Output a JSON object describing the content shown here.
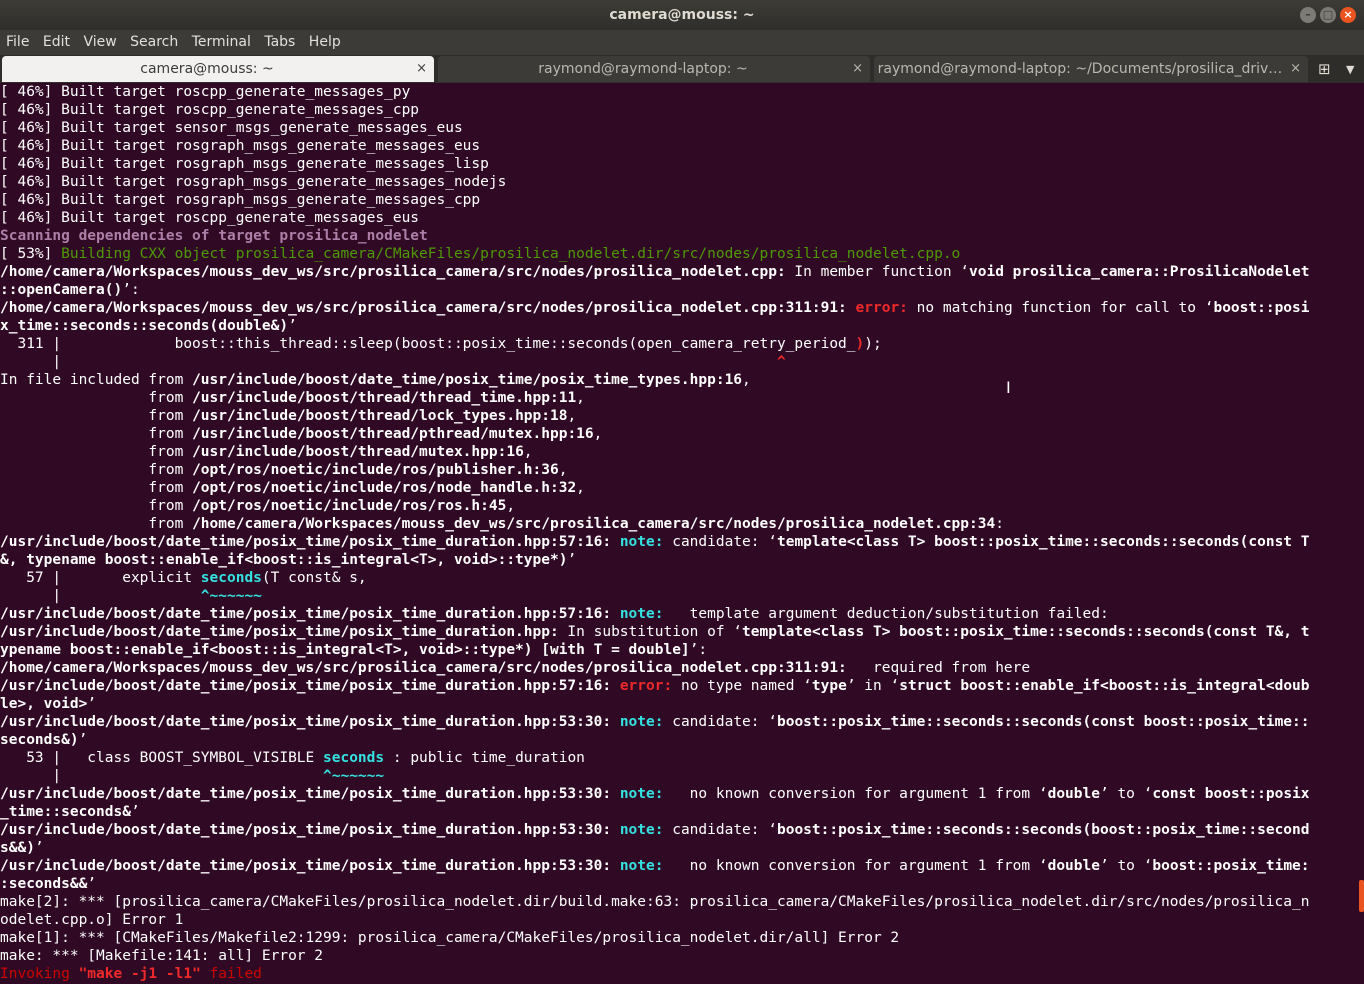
{
  "window": {
    "title": "camera@mouss: ~"
  },
  "menu": [
    "File",
    "Edit",
    "View",
    "Search",
    "Terminal",
    "Tabs",
    "Help"
  ],
  "tabs": [
    {
      "label": "camera@mouss: ~",
      "active": true
    },
    {
      "label": "raymond@raymond-laptop: ~",
      "active": false
    },
    {
      "label": "raymond@raymond-laptop: ~/Documents/prosilica_driv…",
      "active": false
    }
  ],
  "colors": {
    "terminal_bg": "#300a24",
    "accent": "#e95420",
    "note": "#34e2e2",
    "error": "#ef2929",
    "success": "#4e9a06"
  },
  "terminal": {
    "lines": [
      [
        {
          "t": "[ 46%] "
        },
        {
          "t": "Built target roscpp_generate_messages_py"
        }
      ],
      [
        {
          "t": "[ 46%] Built target roscpp_generate_messages_cpp"
        }
      ],
      [
        {
          "t": "[ 46%] Built target sensor_msgs_generate_messages_eus"
        }
      ],
      [
        {
          "t": "[ 46%] Built target rosgraph_msgs_generate_messages_eus"
        }
      ],
      [
        {
          "t": "[ 46%] Built target rosgraph_msgs_generate_messages_lisp"
        }
      ],
      [
        {
          "t": "[ 46%] Built target rosgraph_msgs_generate_messages_nodejs"
        }
      ],
      [
        {
          "t": "[ 46%] Built target rosgraph_msgs_generate_messages_cpp"
        }
      ],
      [
        {
          "t": "[ 46%] Built target roscpp_generate_messages_eus"
        }
      ],
      [
        {
          "t": "Scanning dependencies of target prosilica_nodelet",
          "c": "pur"
        }
      ],
      [
        {
          "t": "[ 53%] "
        },
        {
          "t": "Building CXX object prosilica_camera/CMakeFiles/prosilica_nodelet.dir/src/nodes/prosilica_nodelet.cpp.o",
          "c": "g"
        }
      ],
      [
        {
          "t": "/home/camera/Workspaces/mouss_dev_ws/src/prosilica_camera/src/nodes/prosilica_nodelet.cpp:",
          "c": "b"
        },
        {
          "t": " In member function ‘"
        },
        {
          "t": "void prosilica_camera::ProsilicaNodelet",
          "c": "b"
        }
      ],
      [
        {
          "t": "::openCamera()",
          "c": "b"
        },
        {
          "t": "’:"
        }
      ],
      [
        {
          "t": "/home/camera/Workspaces/mouss_dev_ws/src/prosilica_camera/src/nodes/prosilica_nodelet.cpp:311:91:",
          "c": "b"
        },
        {
          "t": " "
        },
        {
          "t": "error:",
          "c": "err"
        },
        {
          "t": " no matching function for call to ‘"
        },
        {
          "t": "boost::posi",
          "c": "b"
        }
      ],
      [
        {
          "t": "x_time::seconds::seconds(double&)",
          "c": "b"
        },
        {
          "t": "’"
        }
      ],
      [
        {
          "t": "  311 |             boost::this_thread::sleep(boost::posix_time::seconds(open_camera_retry_period_"
        },
        {
          "t": ")",
          "c": "err"
        },
        {
          "t": ");"
        }
      ],
      [
        {
          "t": "      |                                                                                  "
        },
        {
          "t": "^",
          "c": "err"
        }
      ],
      [
        {
          "t": "In file included from "
        },
        {
          "t": "/usr/include/boost/date_time/posix_time/posix_time_types.hpp:16",
          "c": "b"
        },
        {
          "t": ","
        }
      ],
      [
        {
          "t": "                 from "
        },
        {
          "t": "/usr/include/boost/thread/thread_time.hpp:11",
          "c": "b"
        },
        {
          "t": ","
        }
      ],
      [
        {
          "t": "                 from "
        },
        {
          "t": "/usr/include/boost/thread/lock_types.hpp:18",
          "c": "b"
        },
        {
          "t": ","
        }
      ],
      [
        {
          "t": "                 from "
        },
        {
          "t": "/usr/include/boost/thread/pthread/mutex.hpp:16",
          "c": "b"
        },
        {
          "t": ","
        }
      ],
      [
        {
          "t": "                 from "
        },
        {
          "t": "/usr/include/boost/thread/mutex.hpp:16",
          "c": "b"
        },
        {
          "t": ","
        }
      ],
      [
        {
          "t": "                 from "
        },
        {
          "t": "/opt/ros/noetic/include/ros/publisher.h:36",
          "c": "b"
        },
        {
          "t": ","
        }
      ],
      [
        {
          "t": "                 from "
        },
        {
          "t": "/opt/ros/noetic/include/ros/node_handle.h:32",
          "c": "b"
        },
        {
          "t": ","
        }
      ],
      [
        {
          "t": "                 from "
        },
        {
          "t": "/opt/ros/noetic/include/ros/ros.h:45",
          "c": "b"
        },
        {
          "t": ","
        }
      ],
      [
        {
          "t": "                 from "
        },
        {
          "t": "/home/camera/Workspaces/mouss_dev_ws/src/prosilica_camera/src/nodes/prosilica_nodelet.cpp:34",
          "c": "b"
        },
        {
          "t": ":"
        }
      ],
      [
        {
          "t": "/usr/include/boost/date_time/posix_time/posix_time_duration.hpp:57:16:",
          "c": "b"
        },
        {
          "t": " "
        },
        {
          "t": "note:",
          "c": "note"
        },
        {
          "t": " candidate: ‘"
        },
        {
          "t": "template<class T> boost::posix_time::seconds::seconds(const T",
          "c": "b"
        }
      ],
      [
        {
          "t": "&, typename boost::enable_if<boost::is_integral<T>, void>::type*)",
          "c": "b"
        },
        {
          "t": "’"
        }
      ],
      [
        {
          "t": "   57 |       explicit "
        },
        {
          "t": "seconds",
          "c": "cyan"
        },
        {
          "t": "(T const& s,"
        }
      ],
      [
        {
          "t": "      |                "
        },
        {
          "t": "^~~~~~~",
          "c": "cyan"
        }
      ],
      [
        {
          "t": "/usr/include/boost/date_time/posix_time/posix_time_duration.hpp:57:16:",
          "c": "b"
        },
        {
          "t": " "
        },
        {
          "t": "note:",
          "c": "note"
        },
        {
          "t": "   template argument deduction/substitution failed:"
        }
      ],
      [
        {
          "t": "/usr/include/boost/date_time/posix_time/posix_time_duration.hpp:",
          "c": "b"
        },
        {
          "t": " In substitution of ‘"
        },
        {
          "t": "template<class T> boost::posix_time::seconds::seconds(const T&, t",
          "c": "b"
        }
      ],
      [
        {
          "t": "ypename boost::enable_if<boost::is_integral<T>, void>::type*) [with T = double]",
          "c": "b"
        },
        {
          "t": "’:"
        }
      ],
      [
        {
          "t": "/home/camera/Workspaces/mouss_dev_ws/src/prosilica_camera/src/nodes/prosilica_nodelet.cpp:311:91:",
          "c": "b"
        },
        {
          "t": "   required from here"
        }
      ],
      [
        {
          "t": "/usr/include/boost/date_time/posix_time/posix_time_duration.hpp:57:16:",
          "c": "b"
        },
        {
          "t": " "
        },
        {
          "t": "error:",
          "c": "err"
        },
        {
          "t": " no type named ‘"
        },
        {
          "t": "type",
          "c": "b"
        },
        {
          "t": "’ in ‘"
        },
        {
          "t": "struct boost::enable_if<boost::is_integral<doub",
          "c": "b"
        }
      ],
      [
        {
          "t": "le>, void>",
          "c": "b"
        },
        {
          "t": "’"
        }
      ],
      [
        {
          "t": "/usr/include/boost/date_time/posix_time/posix_time_duration.hpp:53:30:",
          "c": "b"
        },
        {
          "t": " "
        },
        {
          "t": "note:",
          "c": "note"
        },
        {
          "t": " candidate: ‘"
        },
        {
          "t": "boost::posix_time::seconds::seconds(const boost::posix_time::",
          "c": "b"
        }
      ],
      [
        {
          "t": "seconds&)",
          "c": "b"
        },
        {
          "t": "’"
        }
      ],
      [
        {
          "t": "   53 |   class BOOST_SYMBOL_VISIBLE "
        },
        {
          "t": "seconds",
          "c": "cyan"
        },
        {
          "t": " : public time_duration"
        }
      ],
      [
        {
          "t": "      |                              "
        },
        {
          "t": "^~~~~~~",
          "c": "cyan"
        }
      ],
      [
        {
          "t": "/usr/include/boost/date_time/posix_time/posix_time_duration.hpp:53:30:",
          "c": "b"
        },
        {
          "t": " "
        },
        {
          "t": "note:",
          "c": "note"
        },
        {
          "t": "   no known conversion for argument 1 from ‘"
        },
        {
          "t": "double",
          "c": "b"
        },
        {
          "t": "’ to ‘"
        },
        {
          "t": "const boost::posix",
          "c": "b"
        }
      ],
      [
        {
          "t": "_time::seconds&",
          "c": "b"
        },
        {
          "t": "’"
        }
      ],
      [
        {
          "t": "/usr/include/boost/date_time/posix_time/posix_time_duration.hpp:53:30:",
          "c": "b"
        },
        {
          "t": " "
        },
        {
          "t": "note:",
          "c": "note"
        },
        {
          "t": " candidate: ‘"
        },
        {
          "t": "boost::posix_time::seconds::seconds(boost::posix_time::second",
          "c": "b"
        }
      ],
      [
        {
          "t": "s&&)",
          "c": "b"
        },
        {
          "t": "’"
        }
      ],
      [
        {
          "t": "/usr/include/boost/date_time/posix_time/posix_time_duration.hpp:53:30:",
          "c": "b"
        },
        {
          "t": " "
        },
        {
          "t": "note:",
          "c": "note"
        },
        {
          "t": "   no known conversion for argument 1 from ‘"
        },
        {
          "t": "double",
          "c": "b"
        },
        {
          "t": "’ to ‘"
        },
        {
          "t": "boost::posix_time:",
          "c": "b"
        }
      ],
      [
        {
          "t": ":seconds&&",
          "c": "b"
        },
        {
          "t": "’"
        }
      ],
      [
        {
          "t": "make[2]: *** [prosilica_camera/CMakeFiles/prosilica_nodelet.dir/build.make:63: prosilica_camera/CMakeFiles/prosilica_nodelet.dir/src/nodes/prosilica_n"
        }
      ],
      [
        {
          "t": "odelet.cpp.o] Error 1"
        }
      ],
      [
        {
          "t": "make[1]: *** [CMakeFiles/Makefile2:1299: prosilica_camera/CMakeFiles/prosilica_nodelet.dir/all] Error 2"
        }
      ],
      [
        {
          "t": "make: *** [Makefile:141: all] Error 2"
        }
      ],
      [
        {
          "t": "Invoking ",
          "c": "red"
        },
        {
          "t": "\"make -j1 -l1\"",
          "c": "err"
        },
        {
          "t": " failed",
          "c": "red"
        }
      ]
    ]
  }
}
